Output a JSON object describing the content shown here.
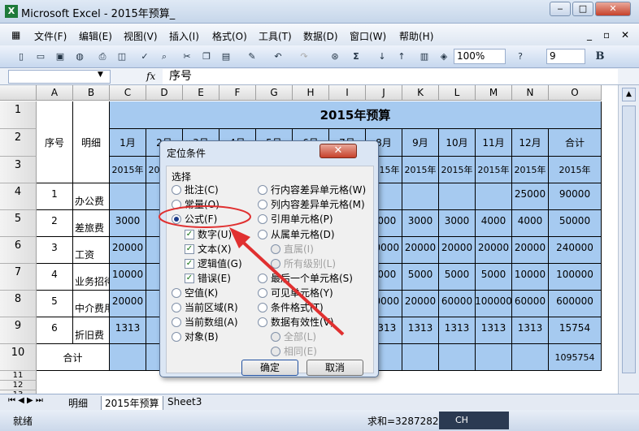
{
  "window": {
    "title": "Microsoft Excel - 2015年预算_"
  },
  "menus": [
    "文件(F)",
    "编辑(E)",
    "视图(V)",
    "插入(I)",
    "格式(O)",
    "工具(T)",
    "数据(D)",
    "窗口(W)",
    "帮助(H)"
  ],
  "toolbar": {
    "zoom": "100%",
    "font_size": "9",
    "bold": "B",
    "sigma": "Σ"
  },
  "formula_bar": {
    "fx": "fx",
    "content": "序号"
  },
  "columns": [
    "A",
    "B",
    "C",
    "D",
    "E",
    "F",
    "G",
    "H",
    "I",
    "J",
    "K",
    "L",
    "M",
    "N",
    "O"
  ],
  "rows": [
    "1",
    "2",
    "3",
    "4",
    "5",
    "6",
    "7",
    "8",
    "9",
    "10",
    "11",
    "12",
    "13"
  ],
  "sheet": {
    "title": "2015年预算",
    "h_seq": "序号",
    "h_detail": "明细",
    "h_total": "合计",
    "months": [
      "1月",
      "2月",
      "3月",
      "4月",
      "5月",
      "6月",
      "7月",
      "8月",
      "9月",
      "10月",
      "11月",
      "12月"
    ],
    "year_labels": [
      "2015年",
      "2015年",
      "2015年",
      "2015年",
      "2015年",
      "2015年",
      "2015年",
      "2015年",
      "2015年",
      "2015年",
      "2015年",
      "2015年",
      "2015年"
    ],
    "data_rows": [
      {
        "seq": "1",
        "name": "办公费",
        "c": "",
        "j": "",
        "k": "",
        "l": "",
        "m": "",
        "n": "25000",
        "o": "90000"
      },
      {
        "seq": "2",
        "name": "差旅费",
        "c": "3000",
        "j": "3000",
        "k": "3000",
        "l": "3000",
        "m": "4000",
        "n": "4000",
        "o": "50000"
      },
      {
        "seq": "3",
        "name": "工资",
        "c": "20000",
        "j": "20000",
        "k": "20000",
        "l": "20000",
        "m": "20000",
        "n": "20000",
        "o": "240000"
      },
      {
        "seq": "4",
        "name": "业务招待费",
        "c": "10000",
        "j": "5000",
        "k": "5000",
        "l": "5000",
        "m": "5000",
        "n": "10000",
        "o": "100000"
      },
      {
        "seq": "5",
        "name": "中介费用",
        "c": "20000",
        "j": "50000",
        "k": "20000",
        "l": "60000",
        "m": "100000",
        "n": "60000",
        "o": "600000"
      },
      {
        "seq": "6",
        "name": "折旧费",
        "c": "1313",
        "j": "1313",
        "k": "1313",
        "l": "1313",
        "m": "1313",
        "n": "1313",
        "o": "15754"
      }
    ],
    "total_label": "合计",
    "grand_total": "1095754"
  },
  "dialog": {
    "title": "定位条件",
    "group": "选择",
    "left_options": [
      "批注(C)",
      "常量(O)",
      "公式(F)",
      "数字(U)",
      "文本(X)",
      "逻辑值(G)",
      "错误(E)",
      "空值(K)",
      "当前区域(R)",
      "当前数组(A)",
      "对象(B)"
    ],
    "right_options": [
      "行内容差异单元格(W)",
      "列内容差异单元格(M)",
      "引用单元格(P)",
      "从属单元格(D)",
      "直属(I)",
      "所有级别(L)",
      "最后一个单元格(S)",
      "可见单元格(Y)",
      "条件格式(T)",
      "数据有效性(V)",
      "全部(L)",
      "相同(E)"
    ],
    "ok": "确定",
    "cancel": "取消",
    "selected": "公式(F)"
  },
  "tabs": [
    "明细",
    "2015年预算",
    "Sheet3"
  ],
  "status": {
    "ready": "就绪",
    "sum": "求和=3287282",
    "ime": "CH"
  },
  "colors": {
    "header_blue": "#a6caf0",
    "annotation": "#e03030"
  }
}
